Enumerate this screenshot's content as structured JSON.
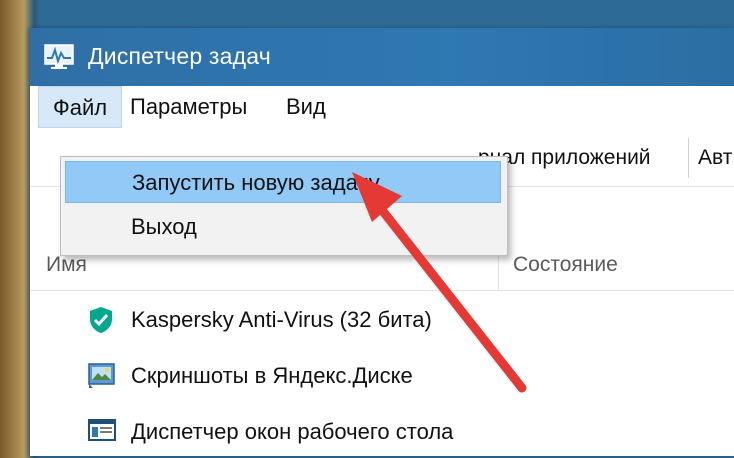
{
  "window": {
    "title": "Диспетчер задач",
    "app_icon": "task-manager-icon",
    "titlebar_color": "#2e78b3"
  },
  "menubar": {
    "items": [
      {
        "label": "Файл",
        "active": true
      },
      {
        "label": "Параметры",
        "active": false
      },
      {
        "label": "Вид",
        "active": false
      }
    ]
  },
  "tabs": {
    "visible_partial": [
      "рнал приложений",
      "Авт"
    ]
  },
  "file_menu": {
    "items": [
      {
        "label": "Запустить новую задачу",
        "highlighted": true
      },
      {
        "label": "Выход",
        "highlighted": false
      }
    ],
    "highlight_color": "#91c9f7"
  },
  "columns": {
    "name": "Имя",
    "status": "Состояние"
  },
  "processes": [
    {
      "name": "Kaspersky Anti-Virus (32 бита)",
      "icon": "kaspersky-shield-icon"
    },
    {
      "name": "Скриншоты в Яндекс.Диске",
      "icon": "screenshot-app-icon"
    },
    {
      "name": "Диспетчер окон рабочего стола",
      "icon": "window-manager-icon"
    }
  ],
  "annotation": {
    "type": "arrow",
    "color": "#e53935",
    "points_to": "Запустить новую задачу"
  }
}
